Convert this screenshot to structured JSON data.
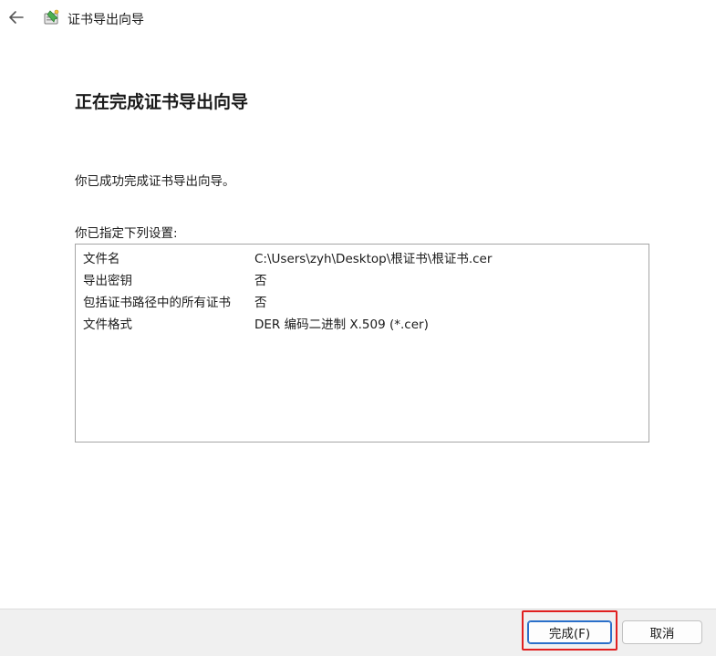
{
  "window": {
    "title": "证书导出向导"
  },
  "heading": "正在完成证书导出向导",
  "success_text": "你已成功完成证书导出向导。",
  "settings_label": "你已指定下列设置:",
  "settings": [
    {
      "key": "文件名",
      "value": "C:\\Users\\zyh\\Desktop\\根证书\\根证书.cer"
    },
    {
      "key": "导出密钥",
      "value": "否"
    },
    {
      "key": "包括证书路径中的所有证书",
      "value": "否"
    },
    {
      "key": "文件格式",
      "value": "DER 编码二进制 X.509 (*.cer)"
    }
  ],
  "buttons": {
    "finish": "完成(F)",
    "cancel": "取消"
  },
  "icons": {
    "back": "back-arrow-icon",
    "wizard": "certificate-wizard-icon"
  },
  "colors": {
    "highlight": "#e02020",
    "default_button_border": "#2a6fc9",
    "footer_bg": "#f0f0f0"
  }
}
